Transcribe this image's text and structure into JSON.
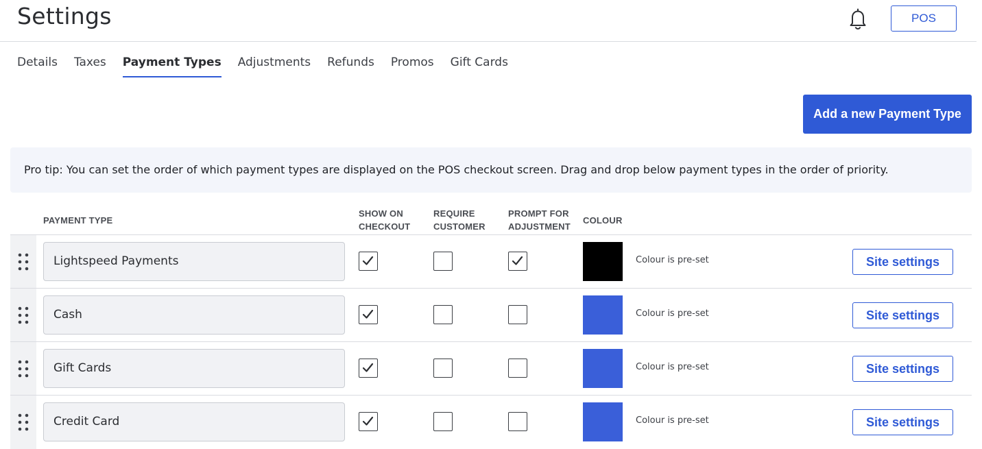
{
  "header": {
    "title": "Settings",
    "pos_label": "POS"
  },
  "tabs": [
    {
      "label": "Details",
      "active": false
    },
    {
      "label": "Taxes",
      "active": false
    },
    {
      "label": "Payment Types",
      "active": true
    },
    {
      "label": "Adjustments",
      "active": false
    },
    {
      "label": "Refunds",
      "active": false
    },
    {
      "label": "Promos",
      "active": false
    },
    {
      "label": "Gift Cards",
      "active": false
    }
  ],
  "add_button_label": "Add a new Payment Type",
  "tip": "Pro tip: You can set the order of which payment types are displayed on the POS checkout screen. Drag and drop below payment types in the order of priority.",
  "table": {
    "headers": {
      "payment_type": "PAYMENT TYPE",
      "show_on_checkout_1": "SHOW ON",
      "show_on_checkout_2": "CHECKOUT",
      "require_customer_1": "REQUIRE",
      "require_customer_2": "CUSTOMER",
      "prompt_adjustment_1": "PROMPT FOR",
      "prompt_adjustment_2": "ADJUSTMENT",
      "colour": "COLOUR"
    },
    "rows": [
      {
        "name": "Lightspeed Payments",
        "show_on_checkout": true,
        "require_customer": false,
        "prompt_for_adjustment": true,
        "colour": "#000000",
        "colour_note": "Colour is pre-set",
        "action": "Site settings"
      },
      {
        "name": "Cash",
        "show_on_checkout": true,
        "require_customer": false,
        "prompt_for_adjustment": false,
        "colour": "#3a5fd9",
        "colour_note": "Colour is pre-set",
        "action": "Site settings"
      },
      {
        "name": "Gift Cards",
        "show_on_checkout": true,
        "require_customer": false,
        "prompt_for_adjustment": false,
        "colour": "#3a5fd9",
        "colour_note": "Colour is pre-set",
        "action": "Site settings"
      },
      {
        "name": "Credit Card",
        "show_on_checkout": true,
        "require_customer": false,
        "prompt_for_adjustment": false,
        "colour": "#3a5fd9",
        "colour_note": "Colour is pre-set",
        "action": "Site settings"
      }
    ]
  },
  "icons": {
    "notifications": "bell-icon",
    "drag": "drag-handle-icon",
    "check": "checkmark-icon"
  },
  "accent_color": "#2f5ad6"
}
